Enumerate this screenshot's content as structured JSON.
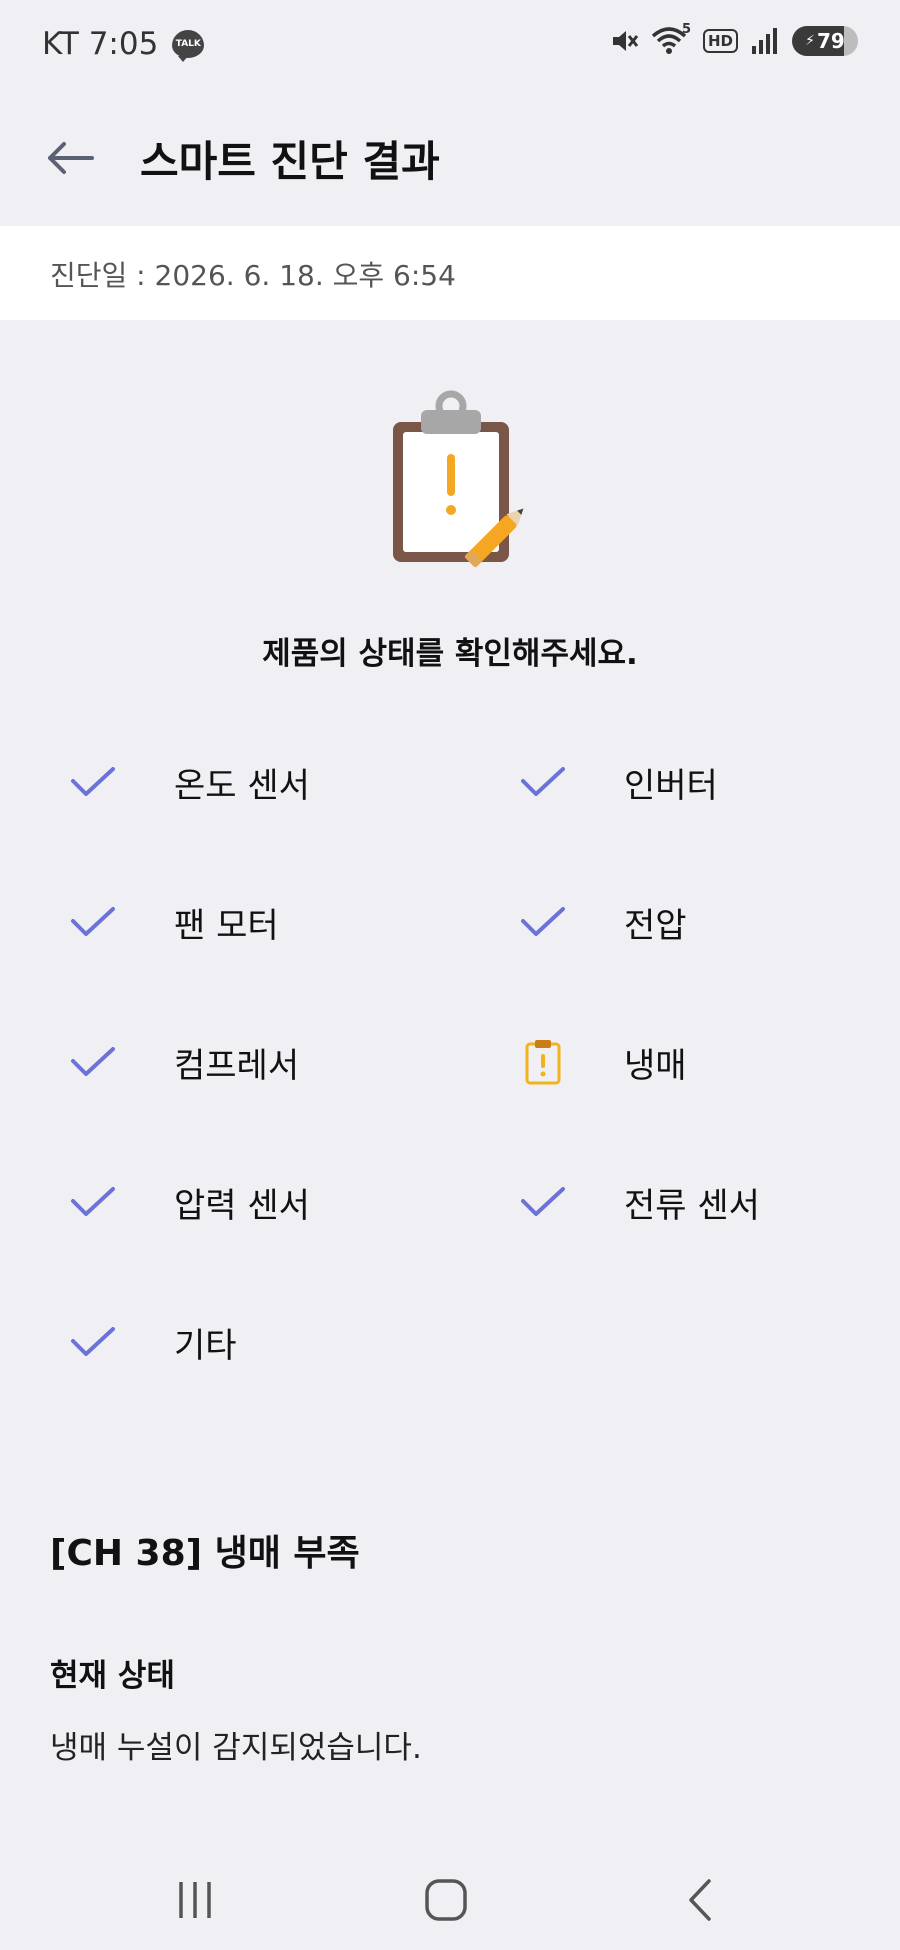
{
  "status_bar": {
    "carrier_time": "KT 7:05",
    "talk_badge": "TALK",
    "wifi_label": "5",
    "hd_label": "HD",
    "battery_level": "79",
    "icons": [
      "mute-icon",
      "wifi-icon",
      "hd-voice-icon",
      "signal-icon",
      "battery-icon"
    ]
  },
  "header": {
    "title": "스마트 진단 결과",
    "back_icon": "back-arrow-icon"
  },
  "diagnosis": {
    "date_label": "진단일 : 2026. 6. 18. 오후 6:54"
  },
  "main": {
    "illustration_icon": "clipboard-warning-icon",
    "prompt": "제품의 상태를 확인해주세요.",
    "check_items": [
      {
        "label": "온도 센서",
        "status": "ok"
      },
      {
        "label": "인버터",
        "status": "ok"
      },
      {
        "label": "팬 모터",
        "status": "ok"
      },
      {
        "label": "전압",
        "status": "ok"
      },
      {
        "label": "컴프레서",
        "status": "ok"
      },
      {
        "label": "냉매",
        "status": "warning"
      },
      {
        "label": "압력 센서",
        "status": "ok"
      },
      {
        "label": "전류 센서",
        "status": "ok"
      },
      {
        "label": "기타",
        "status": "ok"
      }
    ]
  },
  "error": {
    "title": "[CH 38] 냉매 부족",
    "status_heading": "현재 상태",
    "status_desc": "냉매 누설이 감지되었습니다."
  },
  "colors": {
    "check": "#6b73d6",
    "warning": "#f2b21b",
    "background": "#f0f0f4"
  },
  "nav_bar": {
    "buttons": [
      "recent-apps-icon",
      "home-icon",
      "back-icon"
    ]
  }
}
